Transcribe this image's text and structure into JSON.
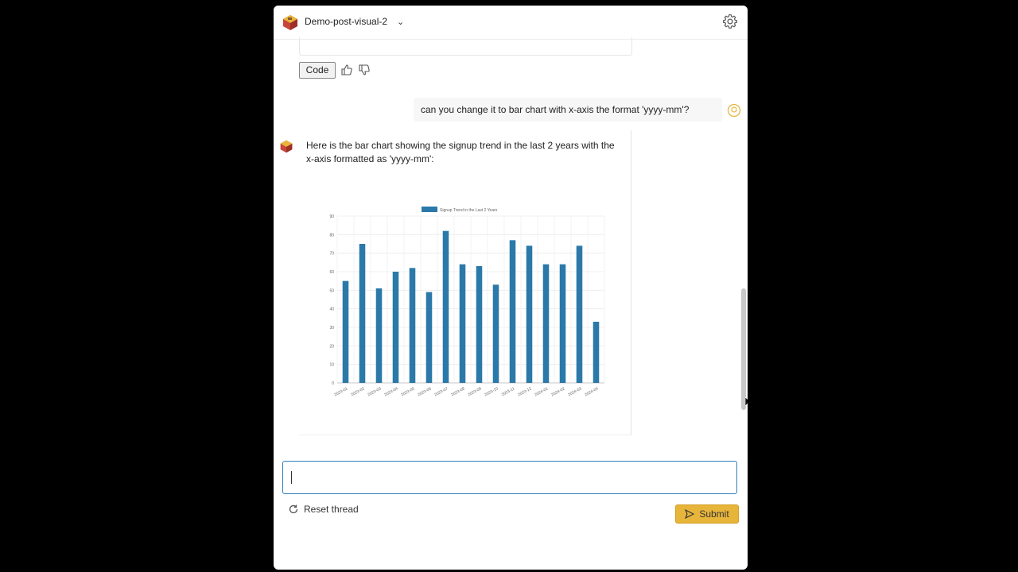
{
  "header": {
    "title": "Demo-post-visual-2"
  },
  "messages": {
    "code_button": "Code",
    "user_prompt": "can you change it to bar chart with x-axis the format 'yyyy-mm'?",
    "bot_reply": "Here is the bar chart showing the signup trend in the last 2 years with the x-axis formatted as 'yyyy-mm':"
  },
  "input": {
    "placeholder": ""
  },
  "footer": {
    "reset_label": "Reset thread",
    "submit_label": "Submit"
  },
  "colors": {
    "bar": "#2b79a9",
    "submit_bg": "#e8b53b",
    "input_border": "#2f7fb6"
  },
  "chart_data": {
    "type": "bar",
    "title": "",
    "legend": "Signup Trend in the Last 2 Years",
    "categories": [
      "2023-01",
      "2023-02",
      "2023-03",
      "2023-04",
      "2023-05",
      "2023-06",
      "2023-07",
      "2023-08",
      "2023-09",
      "2023-10",
      "2023-11",
      "2023-12",
      "2024-01",
      "2024-02",
      "2024-03",
      "2024-04"
    ],
    "values": [
      55,
      75,
      51,
      60,
      62,
      49,
      82,
      64,
      63,
      53,
      77,
      74,
      64,
      64,
      74,
      33
    ],
    "ylim": [
      0,
      90
    ],
    "yticks": [
      0,
      10,
      20,
      30,
      40,
      50,
      60,
      70,
      80,
      90
    ],
    "grid": true,
    "legend_position": "top"
  }
}
